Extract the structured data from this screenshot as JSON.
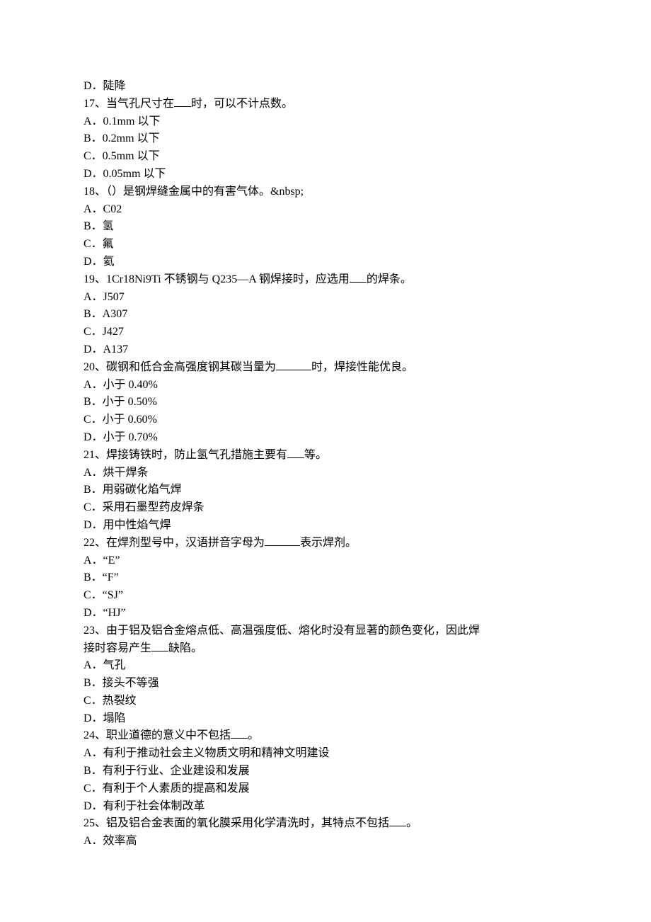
{
  "lines": {
    "q16_d": "D．陡降",
    "q17_stem_pre": "17、当气孔尺寸在",
    "q17_stem_post": "时，可以不计点数。",
    "q17_a": "A．0.1mm 以下",
    "q17_b": "B．0.2mm 以下",
    "q17_c": "C．0.5mm 以下",
    "q17_d": "D．0.05mm 以下",
    "q18_stem": "18、（）是钢焊缝金属中的有害气体。&nbsp;",
    "q18_a": "A．C02",
    "q18_b": "B．氢",
    "q18_c": "C．氟",
    "q18_d": "D．氦",
    "q19_stem_pre": "19、1Cr18Ni9Ti 不锈钢与 Q235—A 钢焊接时，应选用",
    "q19_stem_post": "的焊条。",
    "q19_a": "A．J507",
    "q19_b": "B．A307",
    "q19_c": "C．J427",
    "q19_d": "D．A137",
    "q20_stem_pre": "20、碳钢和低合金高强度钢其碳当量为",
    "q20_stem_post": "时，焊接性能优良。",
    "q20_a": "A．小于 0.40%",
    "q20_b": "B．小于 0.50%",
    "q20_c": "C．小于 0.60%",
    "q20_d": "D．小于 0.70%",
    "q21_stem_pre": "21、焊接铸铁时，防止氢气孔措施主要有",
    "q21_stem_post": "等。",
    "q21_a": "A．烘干焊条",
    "q21_b": "B．用弱碳化焰气焊",
    "q21_c": "C．采用石墨型药皮焊条",
    "q21_d": "D．用中性焰气焊",
    "q22_stem_pre": "22、在焊剂型号中，汉语拼音字母为",
    "q22_stem_post": "表示焊剂。",
    "q22_a": "A．“E”",
    "q22_b": "B．“F”",
    "q22_c": "C．“SJ”",
    "q22_d": "D．“HJ”",
    "q23_stem_line1": "23、由于铝及铝合金熔点低、高温强度低、熔化时没有显著的颜色变化，因此焊",
    "q23_stem_line2_pre": "接时容易产生",
    "q23_stem_line2_post": "缺陷。",
    "q23_a": "A．气孔",
    "q23_b": "B．接头不等强",
    "q23_c": "C．热裂纹",
    "q23_d": "D．塌陷",
    "q24_stem_pre": "24、职业道德的意义中不包括",
    "q24_stem_post": "。",
    "q24_a": "A．有利于推动社会主义物质文明和精神文明建设",
    "q24_b": "B．有利于行业、企业建设和发展",
    "q24_c": "C．有利于个人素质的提高和发展",
    "q24_d": "D．有利于社会体制改革",
    "q25_stem_pre": "25、铝及铝合金表面的氧化膜采用化学清洗时，其特点不包括",
    "q25_stem_post": "。",
    "q25_a": "A．效率高"
  }
}
